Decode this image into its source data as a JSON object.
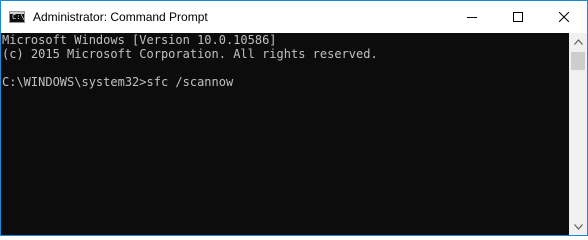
{
  "window": {
    "title": "Administrator: Command Prompt",
    "icon_name": "cmd-icon",
    "icon_glyph": "C:\\",
    "buttons": {
      "minimize_icon": "minimize-icon",
      "maximize_icon": "maximize-icon",
      "close_icon": "close-icon"
    }
  },
  "console": {
    "lines": [
      "Microsoft Windows [Version 10.0.10586]",
      "(c) 2015 Microsoft Corporation. All rights reserved.",
      "",
      "C:\\WINDOWS\\system32>sfc /scannow"
    ],
    "background": "#0c0c0c",
    "text_color": "#c0c0c0"
  },
  "colors": {
    "accent_border": "#1a8ad4",
    "titlebar": "#ffffff",
    "scrollbar_track": "#f0f0f0",
    "scrollbar_thumb": "#cdcdcd"
  }
}
